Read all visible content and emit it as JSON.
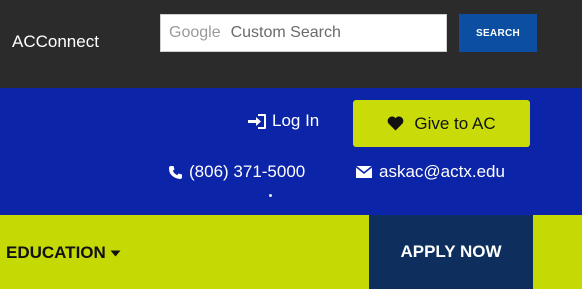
{
  "header": {
    "brand": "ACConnect",
    "search": {
      "provider_label": "Google",
      "placeholder": "Custom Search",
      "button_label": "SEARCH"
    }
  },
  "utility": {
    "login_label": "Log In",
    "give_label": "Give to AC",
    "phone": "(806) 371-5000",
    "email": "askac@actx.edu"
  },
  "nav": {
    "education_label": "EDUCATION",
    "apply_label": "APPLY NOW"
  },
  "colors": {
    "topbar": "#2b2b2b",
    "blue_band": "#0b24a8",
    "lime": "#c5da05",
    "give_button": "#c9dc0a",
    "search_button": "#0b4ea2",
    "apply_button": "#0e2f5e"
  },
  "icons": [
    "sign-in-icon",
    "heart-icon",
    "phone-icon",
    "envelope-icon",
    "caret-down-icon"
  ]
}
